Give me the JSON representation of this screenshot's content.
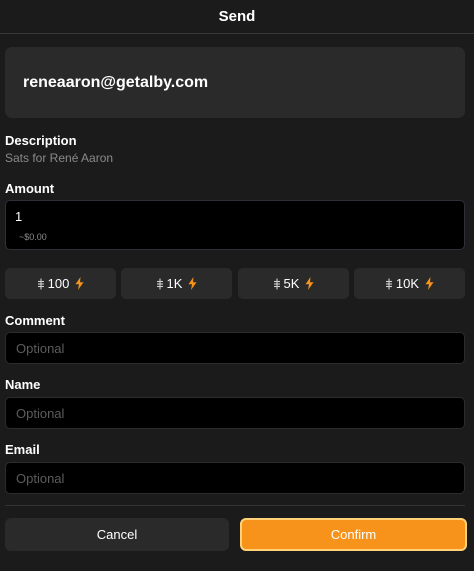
{
  "header": {
    "title": "Send"
  },
  "recipient": {
    "address": "reneaaron@getalby.com"
  },
  "description": {
    "label": "Description",
    "text": "Sats for René Aaron"
  },
  "amount": {
    "label": "Amount",
    "value": "1",
    "fiat": "~$0.00"
  },
  "presets": [
    {
      "label": "100"
    },
    {
      "label": "1K"
    },
    {
      "label": "5K"
    },
    {
      "label": "10K"
    }
  ],
  "comment": {
    "label": "Comment",
    "placeholder": "Optional"
  },
  "name": {
    "label": "Name",
    "placeholder": "Optional"
  },
  "email": {
    "label": "Email",
    "placeholder": "Optional"
  },
  "actions": {
    "cancel_label": "Cancel",
    "confirm_label": "Confirm"
  },
  "colors": {
    "accent": "#f7931a",
    "background": "#1b1b1b",
    "card": "#2a2a2a",
    "input": "#000000"
  }
}
